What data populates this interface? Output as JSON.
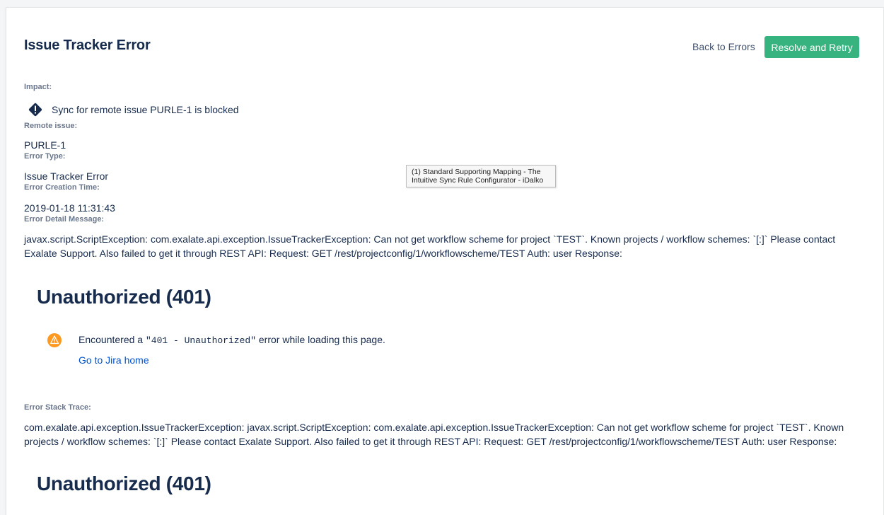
{
  "header": {
    "title": "Issue Tracker Error",
    "back_label": "Back to Errors",
    "resolve_label": "Resolve and Retry"
  },
  "impact": {
    "label": "Impact:",
    "text": "Sync for remote issue PURLE-1 is blocked",
    "icon": "blocked-diamond-icon"
  },
  "remote_issue": {
    "label": "Remote issue:",
    "value": "PURLE-1"
  },
  "error_type": {
    "label": "Error Type:",
    "value": "Issue Tracker Error"
  },
  "creation_time": {
    "label": "Error Creation Time:",
    "value": "2019-01-18 11:31:43"
  },
  "tooltip": {
    "line1": "(1) Standard Supporting Mapping - The",
    "line2": "Intuitive Sync Rule Configurator - iDalko"
  },
  "detail": {
    "label": "Error Detail Message:",
    "message": "javax.script.ScriptException: com.exalate.api.exception.IssueTrackerException: Can not get workflow scheme for project `TEST`. Known projects / workflow schemes: `[:]` Please contact Exalate Support. Also failed to get it through REST API: Request: GET /rest/projectconfig/1/workflowscheme/TEST Auth: user Response:",
    "heading": "Unauthorized (401)",
    "enc_prefix": "Encountered a ",
    "enc_code": "\"401 - Unauthorized\"",
    "enc_suffix": " error while loading this page.",
    "home_link": "Go to Jira home"
  },
  "stack": {
    "label": "Error Stack Trace:",
    "message": "com.exalate.api.exception.IssueTrackerException: javax.script.ScriptException: com.exalate.api.exception.IssueTrackerException: Can not get workflow scheme for project `TEST`. Known projects / workflow schemes: `[:]` Please contact Exalate Support. Also failed to get it through REST API: Request: GET /rest/projectconfig/1/workflowscheme/TEST Auth: user Response:",
    "heading": "Unauthorized (401)"
  },
  "colors": {
    "primary": "#36b37e",
    "link": "#0052cc",
    "warning": "#ff991f",
    "text": "#172b4d",
    "label": "#6b778c"
  }
}
